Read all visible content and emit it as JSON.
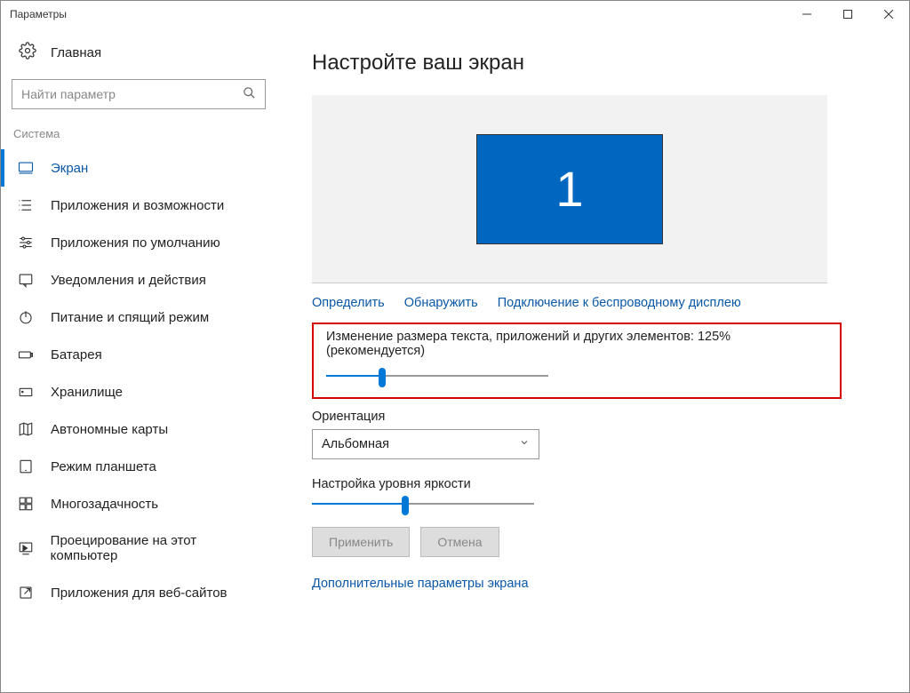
{
  "window": {
    "title": "Параметры"
  },
  "sidebar": {
    "home_label": "Главная",
    "search_placeholder": "Найти параметр",
    "group_label": "Система",
    "items": [
      {
        "label": "Экран"
      },
      {
        "label": "Приложения и возможности"
      },
      {
        "label": "Приложения по умолчанию"
      },
      {
        "label": "Уведомления и действия"
      },
      {
        "label": "Питание и спящий режим"
      },
      {
        "label": "Батарея"
      },
      {
        "label": "Хранилище"
      },
      {
        "label": "Автономные карты"
      },
      {
        "label": "Режим планшета"
      },
      {
        "label": "Многозадачность"
      },
      {
        "label": "Проецирование на этот компьютер"
      },
      {
        "label": "Приложения для веб-сайтов"
      }
    ]
  },
  "main": {
    "title": "Настройте ваш экран",
    "monitor_number": "1",
    "links": {
      "identify": "Определить",
      "detect": "Обнаружить",
      "wireless": "Подключение к беспроводному дисплею"
    },
    "scale_label": "Изменение размера текста, приложений и других элементов: 125% (рекомендуется)",
    "scale_slider_percent": 25,
    "orientation_label": "Ориентация",
    "orientation_value": "Альбомная",
    "brightness_label": "Настройка уровня яркости",
    "brightness_slider_percent": 42,
    "apply_btn": "Применить",
    "cancel_btn": "Отмена",
    "advanced_link": "Дополнительные параметры экрана"
  }
}
